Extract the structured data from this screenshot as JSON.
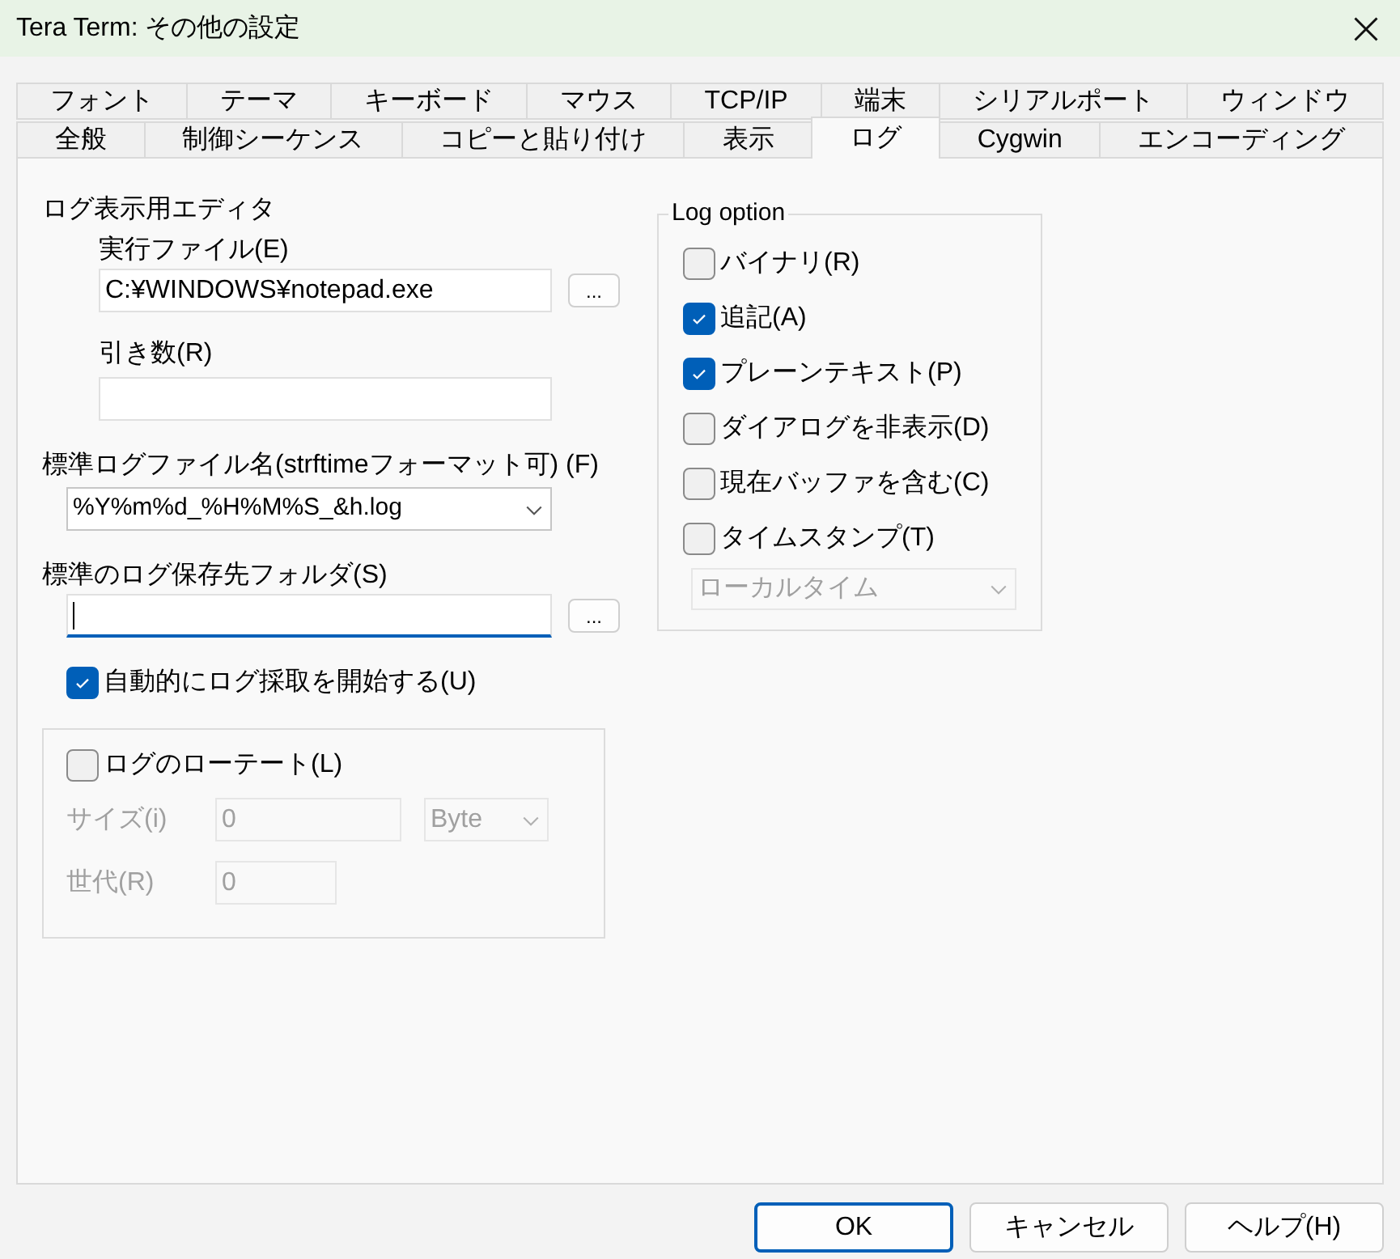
{
  "window": {
    "title": "Tera Term: その他の設定"
  },
  "tab_rows": [
    [
      {
        "label": "フォント",
        "selected": false
      },
      {
        "label": "テーマ",
        "selected": false
      },
      {
        "label": "キーボード",
        "selected": false
      },
      {
        "label": "マウス",
        "selected": false
      },
      {
        "label": "TCP/IP",
        "selected": false
      },
      {
        "label": "端末",
        "selected": false
      },
      {
        "label": "シリアルポート",
        "selected": false
      },
      {
        "label": "ウィンドウ",
        "selected": false
      }
    ],
    [
      {
        "label": "全般",
        "selected": false
      },
      {
        "label": "制御シーケンス",
        "selected": false
      },
      {
        "label": "コピーと貼り付け",
        "selected": false
      },
      {
        "label": "表示",
        "selected": false
      },
      {
        "label": "ログ",
        "selected": true
      },
      {
        "label": "Cygwin",
        "selected": false
      },
      {
        "label": "エンコーディング",
        "selected": false
      }
    ]
  ],
  "editor": {
    "heading": "ログ表示用エディタ",
    "exe_label": "実行ファイル(E)",
    "exe_value": "C:¥WINDOWS¥notepad.exe",
    "exe_browse": "...",
    "args_label": "引き数(R)"
  },
  "filename": {
    "label": "標準ログファイル名(strftimeフォーマット可) (F)",
    "value": "%Y%m%d_%H%M%S_&h.log"
  },
  "folder": {
    "label": "標準のログ保存先フォルダ(S)",
    "focused": true,
    "browse": "..."
  },
  "auto_start": {
    "label": "自動的にログ採取を開始する(U)",
    "checked": true
  },
  "rotate": {
    "label": "ログのローテート(L)",
    "checked": false,
    "disabled": true,
    "size_label": "サイズ(i)",
    "size_value": "0",
    "unit": "Byte",
    "generation_label": "世代(R)",
    "generation_value": "0"
  },
  "log_option": {
    "title": "Log option",
    "options": [
      {
        "label": "バイナリ(R)",
        "checked": false
      },
      {
        "label": "追記(A)",
        "checked": true
      },
      {
        "label": "プレーンテキスト(P)",
        "checked": true
      },
      {
        "label": "ダイアログを非表示(D)",
        "checked": false
      },
      {
        "label": "現在バッファを含む(C)",
        "checked": false
      },
      {
        "label": "タイムスタンプ(T)",
        "checked": false
      }
    ],
    "timestamp_type": {
      "value": "ローカルタイム",
      "disabled": true
    }
  },
  "buttons": [
    {
      "label": "OK",
      "default": true
    },
    {
      "label": "キャンセル",
      "default": false
    },
    {
      "label": "ヘルプ(H)",
      "default": false
    }
  ]
}
